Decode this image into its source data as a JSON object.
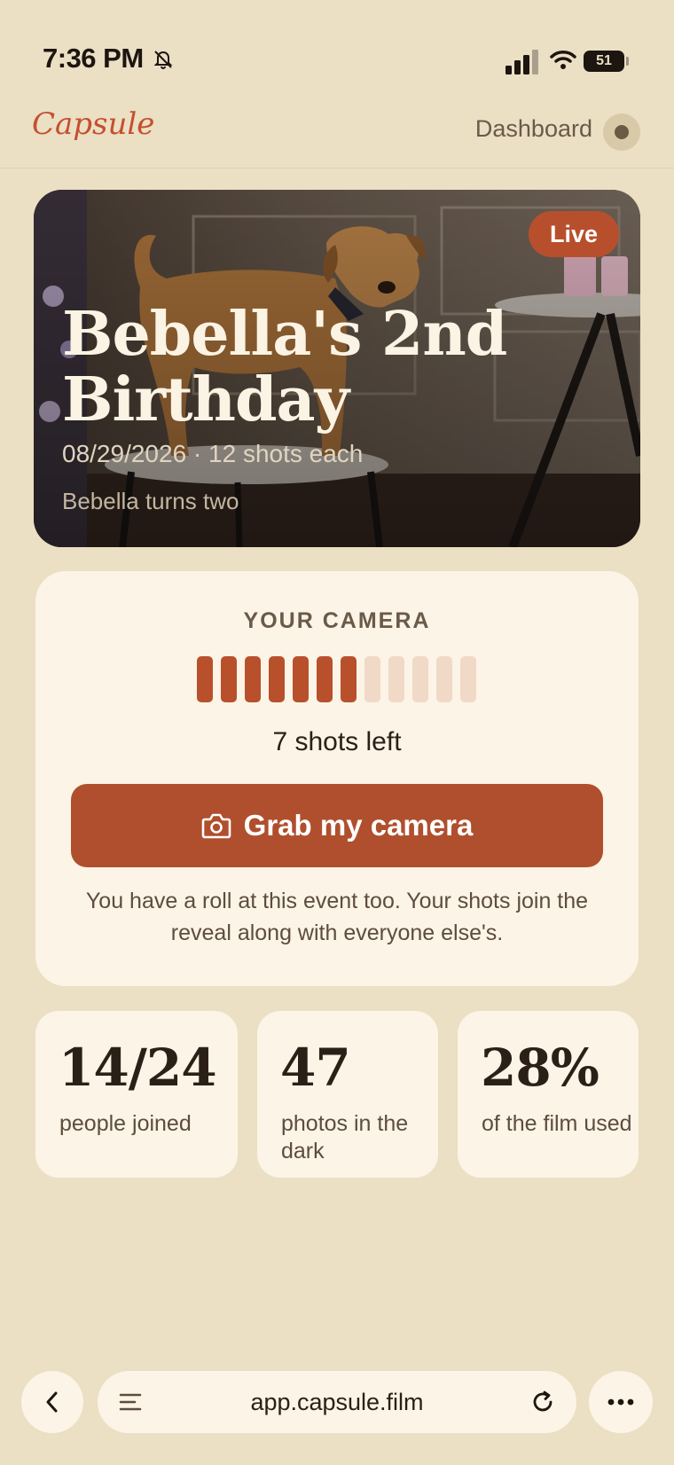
{
  "status_bar": {
    "time": "7:36 PM",
    "battery": "51"
  },
  "nav": {
    "logo": "Capsule",
    "dashboard_label": "Dashboard"
  },
  "event": {
    "badge": "Live",
    "title": "Bebella's 2nd Birthday",
    "meta": "08/29/2026 · 12 shots each",
    "description": "Bebella turns two"
  },
  "camera": {
    "heading": "YOUR CAMERA",
    "shots_total": 12,
    "shots_used": 7,
    "shots_left_label": "7 shots left",
    "button_label": "Grab my camera",
    "note": "You have a roll at this event too. Your shots join the reveal along with everyone else's."
  },
  "stats": [
    {
      "value": "14/24",
      "label": "people joined"
    },
    {
      "value": "47",
      "label": "photos in the dark"
    },
    {
      "value": "28%",
      "label": "of the film used"
    }
  ],
  "browser": {
    "url": "app.capsule.film"
  },
  "colors": {
    "background": "#ebdfc4",
    "card": "#fcf4e6",
    "accent": "#b04f2d",
    "shot_filled": "#b9502c",
    "shot_empty": "#f1d9c7"
  }
}
